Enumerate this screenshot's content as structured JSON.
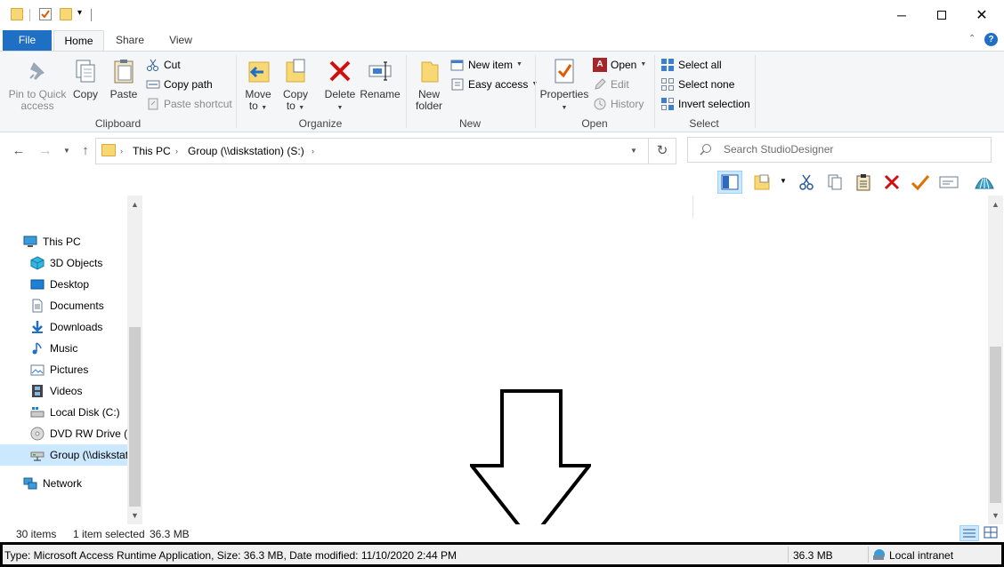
{
  "tabs": {
    "file": "File",
    "home": "Home",
    "share": "Share",
    "view": "View"
  },
  "ribbon": {
    "clipboard": {
      "label": "Clipboard",
      "pin": "Pin to Quick access",
      "pin_line1": "Pin to Quick",
      "pin_line2": "access",
      "copy": "Copy",
      "paste": "Paste",
      "cut": "Cut",
      "copy_path": "Copy path",
      "paste_shortcut": "Paste shortcut"
    },
    "organize": {
      "label": "Organize",
      "move_to_1": "Move",
      "move_to_2": "to",
      "copy_to_1": "Copy",
      "copy_to_2": "to",
      "delete": "Delete",
      "rename": "Rename"
    },
    "new": {
      "label": "New",
      "new_folder_1": "New",
      "new_folder_2": "folder",
      "new_item": "New item",
      "easy_access": "Easy access"
    },
    "open": {
      "label": "Open",
      "properties": "Properties",
      "open": "Open",
      "edit": "Edit",
      "history": "History"
    },
    "select": {
      "label": "Select",
      "select_all": "Select all",
      "select_none": "Select none",
      "invert": "Invert selection"
    }
  },
  "address": {
    "crumbs": [
      "This PC",
      "Group (\\\\diskstation) (S:)"
    ],
    "search_placeholder": "Search StudioDesigner"
  },
  "navpane": {
    "items": [
      {
        "label": "This PC",
        "icon": "monitor-icon"
      },
      {
        "label": "3D Objects",
        "icon": "cube-icon"
      },
      {
        "label": "Desktop",
        "icon": "desktop-icon"
      },
      {
        "label": "Documents",
        "icon": "document-icon"
      },
      {
        "label": "Downloads",
        "icon": "download-icon"
      },
      {
        "label": "Music",
        "icon": "music-icon"
      },
      {
        "label": "Pictures",
        "icon": "pictures-icon"
      },
      {
        "label": "Videos",
        "icon": "film-icon"
      },
      {
        "label": "Local Disk (C:)",
        "icon": "drive-icon"
      },
      {
        "label": "DVD RW Drive (F",
        "icon": "dvd-icon"
      },
      {
        "label": "Group (\\\\diskstation",
        "icon": "network-drive-icon"
      },
      {
        "label": "Network",
        "icon": "network-icon"
      }
    ]
  },
  "status": {
    "items_count": "30 items",
    "selected": "1 item selected",
    "selected_size": "36.3 MB",
    "detail": "Type: Microsoft Access Runtime Application, Size: 36.3 MB, Date modified: 11/10/2020 2:44 PM",
    "size": "36.3 MB",
    "zone": "Local intranet"
  },
  "colors": {
    "accent": "#1f6fc5",
    "selection": "#cce8ff",
    "folder": "#f8d775"
  }
}
